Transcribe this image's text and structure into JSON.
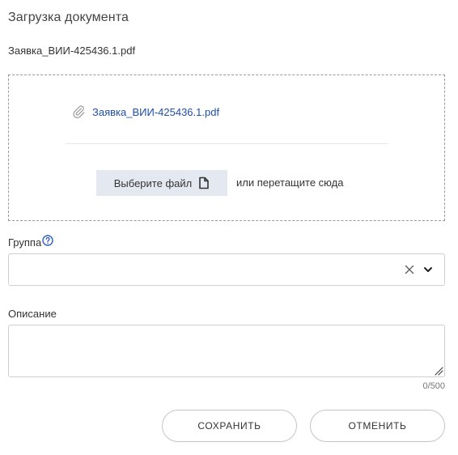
{
  "dialog": {
    "title": "Загрузка документа",
    "filename": "Заявка_ВИИ-425436.1.pdf"
  },
  "dropzone": {
    "attached_file": "Заявка_ВИИ-425436.1.pdf",
    "choose_button_label": "Выберите файл",
    "drag_hint": "или перетащите сюда",
    "icons": {
      "attachment": "paperclip-icon",
      "file": "file-icon"
    }
  },
  "group": {
    "label": "Группа",
    "value": "",
    "icons": {
      "help": "help-icon",
      "clear": "clear-icon",
      "expand": "chevron-down-icon"
    }
  },
  "description": {
    "label": "Описание",
    "value": "",
    "counter": "0/500"
  },
  "actions": {
    "save_label": "СОХРАНИТЬ",
    "cancel_label": "ОТМЕНИТЬ"
  },
  "colors": {
    "link": "#1f4fa8",
    "help_icon": "#2f5fc4",
    "choose_button_bg": "#e4e8f1"
  }
}
